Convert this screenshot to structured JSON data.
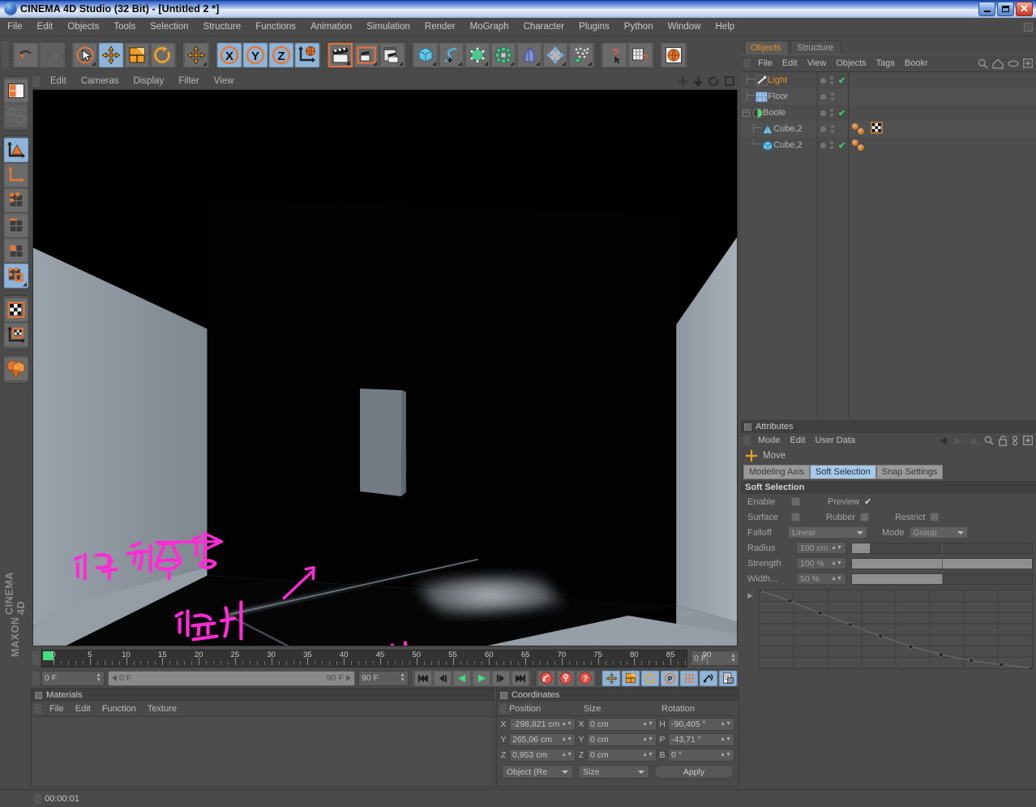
{
  "window": {
    "title": "CINEMA 4D Studio (32 Bit) - [Untitled 2 *]",
    "minimize_label": "_",
    "maximize_label": "□",
    "close_label": "✕"
  },
  "menubar": {
    "items": [
      "File",
      "Edit",
      "Objects",
      "Tools",
      "Selection",
      "Structure",
      "Functions",
      "Animation",
      "Simulation",
      "Render",
      "MoGraph",
      "Character",
      "Plugins",
      "Python",
      "Window",
      "Help"
    ]
  },
  "toolbar": {
    "groups": [
      {
        "name": "undo-redo",
        "buttons": [
          {
            "name": "undo-button",
            "icon": "undo-icon",
            "state": "normal"
          },
          {
            "name": "redo-button",
            "icon": "redo-icon",
            "state": "disabled"
          }
        ]
      },
      {
        "name": "transform-tools",
        "buttons": [
          {
            "name": "live-selection-button",
            "icon": "cursor-circle-icon",
            "state": "normal"
          },
          {
            "name": "move-button",
            "icon": "move-arrows-icon",
            "state": "selected"
          },
          {
            "name": "scale-button",
            "icon": "scale-box-icon",
            "state": "normal"
          },
          {
            "name": "rotate-button",
            "icon": "rotate-icon",
            "state": "normal"
          }
        ]
      },
      {
        "name": "move-single",
        "buttons": [
          {
            "name": "move-tool-button",
            "icon": "move-arrows-icon",
            "state": "normal"
          }
        ]
      },
      {
        "name": "axis-locks",
        "buttons": [
          {
            "name": "lock-x-button",
            "icon": "x-axis-icon",
            "label": "X",
            "state": "selected"
          },
          {
            "name": "lock-y-button",
            "icon": "y-axis-icon",
            "label": "Y",
            "state": "selected"
          },
          {
            "name": "lock-z-button",
            "icon": "z-axis-icon",
            "label": "Z",
            "state": "selected"
          },
          {
            "name": "world-coordinates-button",
            "icon": "globe-axis-icon",
            "state": "selected"
          }
        ]
      },
      {
        "name": "render-tools",
        "buttons": [
          {
            "name": "render-view-button",
            "icon": "clapperboard-icon",
            "state": "highlighted"
          },
          {
            "name": "render-region-button",
            "icon": "clapperboard-region-icon",
            "state": "normal"
          },
          {
            "name": "render-settings-button",
            "icon": "render-settings-icon",
            "state": "normal"
          }
        ]
      },
      {
        "name": "object-tools",
        "buttons": [
          {
            "name": "add-cube-button",
            "icon": "cube-icon",
            "state": "normal"
          },
          {
            "name": "add-spline-button",
            "icon": "spline-icon",
            "state": "normal"
          },
          {
            "name": "nurbs-button",
            "icon": "hyper-nurbs-icon",
            "state": "normal"
          },
          {
            "name": "array-button",
            "icon": "array-icon",
            "state": "normal"
          },
          {
            "name": "deformer-button",
            "icon": "bend-deformer-icon",
            "state": "normal"
          },
          {
            "name": "environment-button",
            "icon": "light-burst-icon",
            "state": "normal"
          },
          {
            "name": "particles-button",
            "icon": "particles-icon",
            "state": "normal"
          }
        ]
      },
      {
        "name": "help-tools",
        "buttons": [
          {
            "name": "help-cursor-button",
            "icon": "question-cursor-icon",
            "state": "normal"
          },
          {
            "name": "content-browser-button",
            "icon": "table-question-icon",
            "state": "normal"
          }
        ]
      },
      {
        "name": "web-tools",
        "buttons": [
          {
            "name": "web-button",
            "icon": "globe-icon",
            "state": "normal"
          }
        ]
      }
    ]
  },
  "left_toolbar": {
    "groups": [
      {
        "buttons": [
          {
            "name": "layout-button",
            "icon": "layout-grid-icon",
            "state": "normal"
          },
          {
            "name": "viewport-rotate-button",
            "icon": "globe-rotate-icon",
            "state": "disabled"
          }
        ]
      },
      {
        "buttons": [
          {
            "name": "object-mode-button",
            "icon": "object-axis-icon",
            "state": "selected"
          },
          {
            "name": "model-mode-button",
            "icon": "axis-corner-icon",
            "state": "normal"
          },
          {
            "name": "point-mode-button",
            "icon": "points-grid-icon",
            "state": "normal"
          },
          {
            "name": "edge-mode-button",
            "icon": "edge-grid-icon",
            "state": "normal"
          },
          {
            "name": "polygon-mode-button",
            "icon": "polygon-grid-icon",
            "state": "normal"
          },
          {
            "name": "uv-mode-button",
            "icon": "uv-polygon-icon",
            "state": "selected"
          }
        ]
      },
      {
        "buttons": [
          {
            "name": "texture-mode-button",
            "icon": "checker-icon",
            "state": "normal"
          },
          {
            "name": "texture-axis-button",
            "icon": "checker-axis-icon",
            "state": "normal"
          }
        ]
      },
      {
        "buttons": [
          {
            "name": "workplane-button",
            "icon": "objects-primitives-icon",
            "state": "normal"
          }
        ]
      }
    ],
    "logo_line1": "MAXON",
    "logo_line2": "CINEMA 4D"
  },
  "viewport": {
    "menu_items": [
      "Edit",
      "Cameras",
      "Display",
      "Filter",
      "View"
    ],
    "corner_icons": [
      "pan-icon",
      "dolly-icon",
      "rotate-view-icon",
      "maximize-view-icon"
    ],
    "annotations": [
      {
        "name": "annotation-line-1",
        "text": "이건 천상의"
      },
      {
        "name": "annotation-line-2",
        "text": "이유가"
      },
      {
        "name": "annotation-line-3",
        "text": "궁금합니다!!"
      }
    ],
    "ink_color": "#ff2bd6"
  },
  "timeline": {
    "ticks": [
      {
        "label": "0",
        "pos": 0
      },
      {
        "label": "5",
        "pos": 5
      },
      {
        "label": "10",
        "pos": 10
      },
      {
        "label": "15",
        "pos": 15
      },
      {
        "label": "20",
        "pos": 20
      },
      {
        "label": "25",
        "pos": 25
      },
      {
        "label": "30",
        "pos": 30
      },
      {
        "label": "35",
        "pos": 35
      },
      {
        "label": "40",
        "pos": 40
      },
      {
        "label": "45",
        "pos": 45
      },
      {
        "label": "50",
        "pos": 50
      },
      {
        "label": "55",
        "pos": 55
      },
      {
        "label": "60",
        "pos": 60
      },
      {
        "label": "65",
        "pos": 65
      },
      {
        "label": "70",
        "pos": 70
      },
      {
        "label": "75",
        "pos": 75
      },
      {
        "label": "80",
        "pos": 80
      },
      {
        "label": "85",
        "pos": 85
      },
      {
        "label": "90",
        "pos": 90
      }
    ],
    "range_max": 90,
    "current_frame_field": "0 F",
    "end_frame_field": "0 F",
    "scrub_start": "0 F",
    "scrub_end": "90 F",
    "preview_end": "90 F",
    "transport": [
      {
        "name": "go-to-start-button",
        "icon": "skip-start-icon"
      },
      {
        "name": "step-back-button",
        "icon": "step-back-icon"
      },
      {
        "name": "play-reverse-button",
        "icon": "play-reverse-icon"
      },
      {
        "name": "play-button",
        "icon": "play-icon"
      },
      {
        "name": "step-forward-button",
        "icon": "step-forward-icon"
      },
      {
        "name": "go-to-end-button",
        "icon": "skip-end-icon"
      }
    ],
    "record": [
      {
        "name": "record-keyframe-button",
        "icon": "record-key-icon"
      },
      {
        "name": "autokey-button",
        "icon": "autokey-icon"
      },
      {
        "name": "keyframe-selection-button",
        "icon": "key-selection-icon"
      }
    ],
    "keytoggles": [
      {
        "name": "key-position-button",
        "icon": "move-arrows-icon",
        "state": "selected"
      },
      {
        "name": "key-scale-button",
        "icon": "scale-box-icon",
        "state": "selected"
      },
      {
        "name": "key-rotation-button",
        "icon": "rotate-icon",
        "state": "selected"
      },
      {
        "name": "key-parameter-button",
        "icon": "parameter-icon",
        "state": "selected"
      },
      {
        "name": "key-pla-button",
        "icon": "pla-points-icon",
        "state": "selected"
      },
      {
        "name": "key-auto-button",
        "icon": "autokey-wave-icon",
        "state": "selected"
      },
      {
        "name": "key-mode-button",
        "icon": "key-mode-icon",
        "state": "selected"
      }
    ]
  },
  "materials": {
    "title": "Materials",
    "menu_items": [
      "File",
      "Edit",
      "Function",
      "Texture"
    ]
  },
  "coordinates": {
    "title": "Coordinates",
    "headers": [
      "Position",
      "Size",
      "Rotation"
    ],
    "rows": [
      {
        "pos_axis": "X",
        "pos_value": "-298,821 cm",
        "size_axis": "X",
        "size_value": "0 cm",
        "rot_axis": "H",
        "rot_value": "-90,405 °"
      },
      {
        "pos_axis": "Y",
        "pos_value": "265,06 cm",
        "size_axis": "Y",
        "size_value": "0 cm",
        "rot_axis": "P",
        "rot_value": "-43,71 °"
      },
      {
        "pos_axis": "Z",
        "pos_value": "0,953 cm",
        "size_axis": "Z",
        "size_value": "0 cm",
        "rot_axis": "B",
        "rot_value": "0 °"
      }
    ],
    "object_mode": "Object (Re",
    "size_mode": "Size",
    "apply_label": "Apply"
  },
  "statusbar": {
    "time": "00:00:01"
  },
  "objects_panel": {
    "tabs": [
      {
        "name": "tab-objects",
        "label": "Objects",
        "active": true
      },
      {
        "name": "tab-structure",
        "label": "Structure",
        "active": false
      }
    ],
    "menu_items": [
      "File",
      "Edit",
      "View",
      "Objects",
      "Tags",
      "Bookr"
    ],
    "header_icons": [
      "search-icon",
      "home-icon",
      "eye-icon",
      "plus-box-icon"
    ],
    "tree": [
      {
        "name": "object-light",
        "label": "Light",
        "icon": "light-icon",
        "depth": 0,
        "highlighted": true,
        "visible_dot": true,
        "check": true,
        "tags": []
      },
      {
        "name": "object-floor",
        "label": "Floor",
        "icon": "floor-icon",
        "depth": 0,
        "highlighted": false,
        "visible_dot": true,
        "check": false,
        "tags": []
      },
      {
        "name": "object-boole",
        "label": "Boole",
        "icon": "boole-icon",
        "depth": 0,
        "highlighted": false,
        "visible_dot": true,
        "check": true,
        "expander": "−",
        "tags": []
      },
      {
        "name": "object-cube-2a",
        "label": "Cube,2",
        "icon": "cone-icon",
        "depth": 1,
        "highlighted": false,
        "visible_dot": true,
        "check": false,
        "tags": [
          "material-tag",
          "material-tag",
          "texture-tag"
        ]
      },
      {
        "name": "object-cube-2b",
        "label": "Cube,2",
        "icon": "cube-blue-icon",
        "depth": 1,
        "highlighted": false,
        "visible_dot": true,
        "check": true,
        "tags": [
          "material-tag",
          "material-tag"
        ]
      }
    ]
  },
  "attributes_panel": {
    "title": "Attributes",
    "menu_items": [
      "Mode",
      "Edit",
      "User Data"
    ],
    "header_icons": [
      "back-arrow-icon",
      "forward-arrow-icon",
      "up-arrow-icon",
      "search-icon",
      "lock-icon",
      "chain-icon",
      "plus-box-icon"
    ],
    "active_tool": "Move",
    "active_tool_icon": "move-plus-icon",
    "mode_tabs": [
      {
        "name": "tab-modeling-axis",
        "label": "Modeling Axis",
        "active": false
      },
      {
        "name": "tab-soft-selection",
        "label": "Soft Selection",
        "active": true
      },
      {
        "name": "tab-snap-settings",
        "label": "Snap Settings",
        "active": false
      }
    ],
    "section_title": "Soft Selection",
    "checkboxes": [
      {
        "name": "enable-checkbox",
        "label": "Enable",
        "checked": false
      },
      {
        "name": "preview-checkbox",
        "label": "Preview",
        "checked": true
      },
      {
        "name": "surface-checkbox",
        "label": "Surface",
        "checked": false
      },
      {
        "name": "rubber-checkbox",
        "label": "Rubber",
        "checked": false
      },
      {
        "name": "restrict-checkbox",
        "label": "Restrict",
        "checked": false
      }
    ],
    "falloff_label": "Falloff",
    "falloff_value": "Linear",
    "mode_label": "Mode",
    "mode_value": "Group",
    "sliders": [
      {
        "name": "radius-slider",
        "label": "Radius",
        "value": "100 cm",
        "fill_pct": 10
      },
      {
        "name": "strength-slider",
        "label": "Strength",
        "value": "100 %",
        "fill_pct": 100
      },
      {
        "name": "width-slider",
        "label": "Width...",
        "value": "50 %",
        "fill_pct": 50
      }
    ],
    "curve": {
      "points": [
        [
          0,
          0
        ],
        [
          0.111,
          0.135
        ],
        [
          0.222,
          0.29
        ],
        [
          0.333,
          0.44
        ],
        [
          0.444,
          0.585
        ],
        [
          0.555,
          0.72
        ],
        [
          0.666,
          0.825
        ],
        [
          0.777,
          0.9
        ],
        [
          0.888,
          0.955
        ],
        [
          1.0,
          1.0
        ]
      ],
      "grid_cols": 8,
      "grid_rows": 7
    }
  },
  "colors": {
    "accent_orange": "#e8921f",
    "selected_blue": "#8fb4d9",
    "panel_bg": "#4a4a4a",
    "ink_pink": "#ff2bd6",
    "check_green": "#46c46a",
    "timeline_green": "#44dd7e"
  }
}
